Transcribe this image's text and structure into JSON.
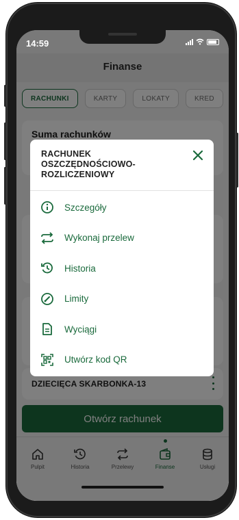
{
  "status_bar": {
    "time": "14:59"
  },
  "header": {
    "title": "Finanse"
  },
  "tabs": [
    {
      "label": "RACHUNKI",
      "active": true
    },
    {
      "label": "KARTY",
      "active": false
    },
    {
      "label": "LOKATY",
      "active": false
    },
    {
      "label": "KRED",
      "active": false
    }
  ],
  "summary_card": {
    "title": "Suma rachunków"
  },
  "kids_account": {
    "name": "DZIECIĘCA SKARBONKA-13"
  },
  "open_account_button": "Otwórz rachunek",
  "bottom_nav": [
    {
      "label": "Pulpit",
      "icon": "home-icon",
      "active": false
    },
    {
      "label": "Historia",
      "icon": "history-icon",
      "active": false
    },
    {
      "label": "Przelewy",
      "icon": "transfer-icon",
      "active": false
    },
    {
      "label": "Finanse",
      "icon": "wallet-icon",
      "active": true
    },
    {
      "label": "Usługi",
      "icon": "services-icon",
      "active": false
    }
  ],
  "modal": {
    "title": "RACHUNEK OSZCZĘDNOŚCIOWO-ROZLICZENIOWY",
    "items": [
      {
        "label": "Szczegóły",
        "icon": "info-icon"
      },
      {
        "label": "Wykonaj przelew",
        "icon": "transfer-icon"
      },
      {
        "label": "Historia",
        "icon": "history-icon"
      },
      {
        "label": "Limity",
        "icon": "gauge-icon"
      },
      {
        "label": "Wyciągi",
        "icon": "document-icon"
      },
      {
        "label": "Utwórz kod QR",
        "icon": "qr-code-icon"
      }
    ]
  },
  "colors": {
    "accent": "#1a6a3c",
    "overlay": "rgba(0,0,0,0.5)"
  }
}
